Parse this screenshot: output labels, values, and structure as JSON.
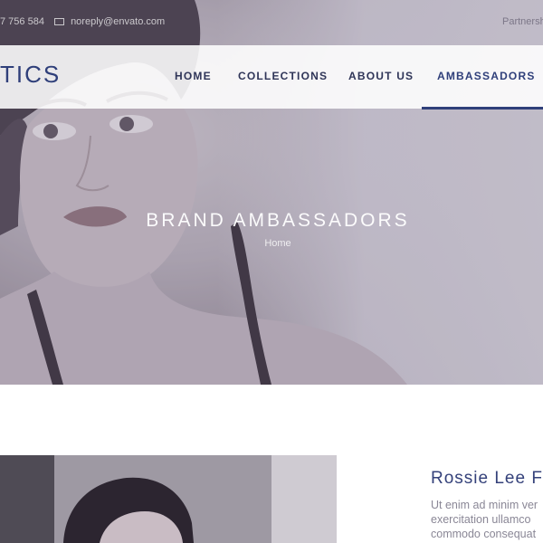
{
  "topbar": {
    "phone": "7 756 584",
    "email": "noreply@envato.com",
    "partnership_link": "Partnership"
  },
  "nav": {
    "logo_text": "TICS",
    "items": [
      {
        "label": "HOME"
      },
      {
        "label": "COLLECTIONS"
      },
      {
        "label": "ABOUT US"
      },
      {
        "label": "AMBASSADORS"
      }
    ],
    "active_item": "AMBASSADORS"
  },
  "hero": {
    "title": "BRAND AMBASSADORS",
    "breadcrumb": "Home"
  },
  "ambassador": {
    "name": "Rossie Lee F",
    "bio_lines": [
      "Ut enim ad minim ver",
      "exercitation ullamco",
      "commodo consequat"
    ]
  },
  "colors": {
    "brand": "#2f3f7a",
    "nav_text": "#2f3558",
    "muted_text": "#8a8796"
  }
}
